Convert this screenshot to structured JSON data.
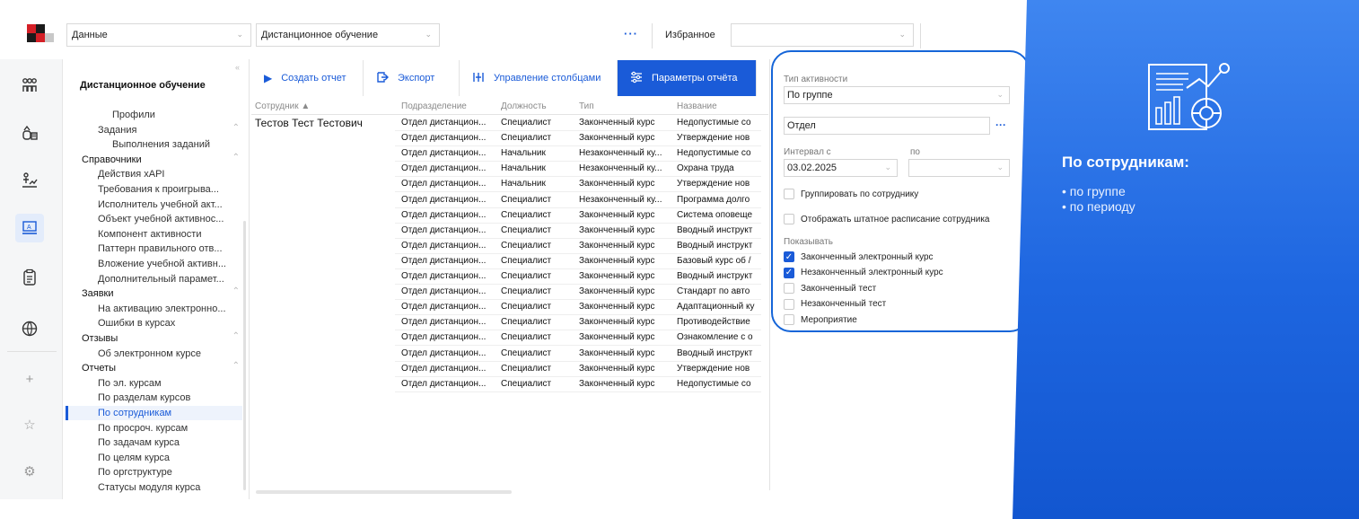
{
  "topbar": {
    "section_select": "Данные",
    "module_select": "Дистанционное обучение",
    "more": "···",
    "favorites_label": "Избранное",
    "favorites_value": ""
  },
  "nav": {
    "title": "Дистанционное обучение",
    "items": [
      {
        "label": "Профили",
        "level": 2
      },
      {
        "label": "Задания",
        "level": 1,
        "caret": true
      },
      {
        "label": "Выполнения заданий",
        "level": 2
      },
      {
        "label": "Справочники",
        "level": 0,
        "caret": true
      },
      {
        "label": "Действия xAPI",
        "level": 1
      },
      {
        "label": "Требования к проигрыва...",
        "level": 1
      },
      {
        "label": "Исполнитель учебной акт...",
        "level": 1
      },
      {
        "label": "Объект учебной активнос...",
        "level": 1
      },
      {
        "label": "Компонент активности",
        "level": 1
      },
      {
        "label": "Паттерн правильного отв...",
        "level": 1
      },
      {
        "label": "Вложение учебной активн...",
        "level": 1
      },
      {
        "label": "Дополнительный парамет...",
        "level": 1
      },
      {
        "label": "Заявки",
        "level": 0,
        "caret": true
      },
      {
        "label": "На активацию электронно...",
        "level": 1
      },
      {
        "label": "Ошибки в курсах",
        "level": 1
      },
      {
        "label": "Отзывы",
        "level": 0,
        "caret": true
      },
      {
        "label": "Об электронном курсе",
        "level": 1
      },
      {
        "label": "Отчеты",
        "level": 0,
        "caret": true
      },
      {
        "label": "По эл. курсам",
        "level": 1
      },
      {
        "label": "По разделам курсов",
        "level": 1
      },
      {
        "label": "По сотрудникам",
        "level": 1,
        "active": true
      },
      {
        "label": "По просроч. курсам",
        "level": 1
      },
      {
        "label": "По задачам курса",
        "level": 1
      },
      {
        "label": "По целям курса",
        "level": 1
      },
      {
        "label": "По оргструктуре",
        "level": 1
      },
      {
        "label": "Статусы модуля курса",
        "level": 1
      }
    ]
  },
  "toolbar": {
    "create_report": "Создать отчет",
    "export": "Экспорт",
    "manage_columns": "Управление столбцами",
    "report_params": "Параметры отчёта"
  },
  "grid": {
    "columns": [
      "Сотрудник ▲",
      "Подразделение",
      "Должность",
      "Тип",
      "Название"
    ],
    "employee": "Тестов Тест Тестович",
    "rows": [
      [
        "Отдел дистанцион...",
        "Специалист",
        "Законченный курс",
        "Недопустимые со"
      ],
      [
        "Отдел дистанцион...",
        "Специалист",
        "Законченный курс",
        "Утверждение нов"
      ],
      [
        "Отдел дистанцион...",
        "Начальник",
        "Незаконченный ку...",
        "Недопустимые со"
      ],
      [
        "Отдел дистанцион...",
        "Начальник",
        "Незаконченный ку...",
        "Охрана труда"
      ],
      [
        "Отдел дистанцион...",
        "Начальник",
        "Законченный курс",
        "Утверждение нов"
      ],
      [
        "Отдел дистанцион...",
        "Специалист",
        "Незаконченный ку...",
        "Программа долго"
      ],
      [
        "Отдел дистанцион...",
        "Специалист",
        "Законченный курс",
        "Система оповеще"
      ],
      [
        "Отдел дистанцион...",
        "Специалист",
        "Законченный курс",
        "Вводный инструкт"
      ],
      [
        "Отдел дистанцион...",
        "Специалист",
        "Законченный курс",
        "Вводный инструкт"
      ],
      [
        "Отдел дистанцион...",
        "Специалист",
        "Законченный курс",
        "Базовый курс об /"
      ],
      [
        "Отдел дистанцион...",
        "Специалист",
        "Законченный курс",
        "Вводный инструкт"
      ],
      [
        "Отдел дистанцион...",
        "Специалист",
        "Законченный курс",
        "Стандарт по авто"
      ],
      [
        "Отдел дистанцион...",
        "Специалист",
        "Законченный курс",
        "Адаптационный ку"
      ],
      [
        "Отдел дистанцион...",
        "Специалист",
        "Законченный курс",
        "Противодействие"
      ],
      [
        "Отдел дистанцион...",
        "Специалист",
        "Законченный курс",
        "Ознакомление с о"
      ],
      [
        "Отдел дистанцион...",
        "Специалист",
        "Законченный курс",
        "Вводный инструкт"
      ],
      [
        "Отдел дистанцион...",
        "Специалист",
        "Законченный курс",
        "Утверждение нов"
      ],
      [
        "Отдел дистанцион...",
        "Специалист",
        "Законченный курс",
        "Недопустимые со"
      ]
    ]
  },
  "params": {
    "activity_type_label": "Тип активности",
    "activity_type_value": "По группе",
    "department_value": "Отдел",
    "department_more": "···",
    "interval_from_label": "Интервал с",
    "interval_to_label": "по",
    "interval_from_value": "03.02.2025",
    "interval_to_value": "",
    "group_by_employee": {
      "label": "Группировать по сотруднику",
      "checked": false
    },
    "show_staff_schedule": {
      "label": "Отображать штатное расписание сотрудника",
      "checked": false
    },
    "show_label": "Показывать",
    "show_options": [
      {
        "label": "Законченный электронный курс",
        "checked": true
      },
      {
        "label": "Незаконченный электронный курс",
        "checked": true
      },
      {
        "label": "Законченный тест",
        "checked": false
      },
      {
        "label": "Незаконченный тест",
        "checked": false
      },
      {
        "label": "Мероприятие",
        "checked": false
      }
    ]
  },
  "promo": {
    "title": "По сотрудникам:",
    "items": [
      "• по группе",
      "• по периоду"
    ]
  },
  "colors": {
    "accent": "#1a5bd8",
    "highlight_border": "#1565d8",
    "promo_bg": "#1e66e0"
  }
}
